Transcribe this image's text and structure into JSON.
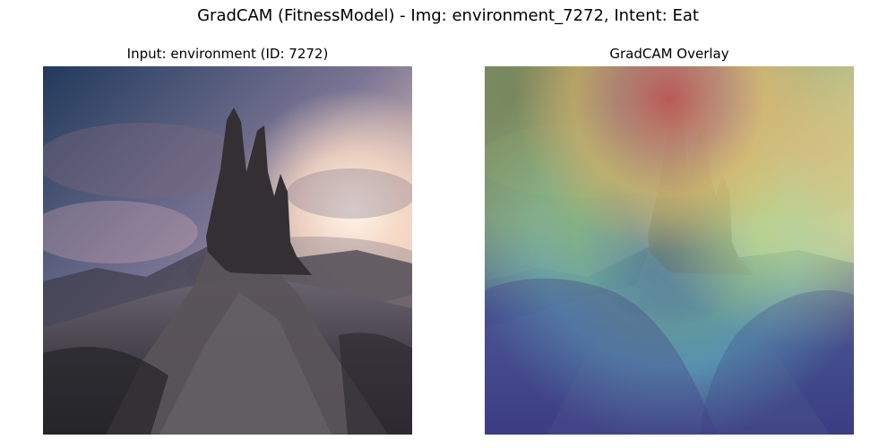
{
  "figure": {
    "suptitle": "GradCAM (FitnessModel) - Img: environment_7272, Intent: Eat"
  },
  "panels": {
    "input": {
      "title": "Input: environment (ID: 7272)"
    },
    "overlay": {
      "title": "GradCAM Overlay"
    }
  },
  "colors": {
    "sky_top": "#1f3454",
    "sky_glow": "#f6dcc5",
    "rock": "#3d3637",
    "ground": "#4b454b",
    "heat_hot": "#c63a3e",
    "heat_warm": "#f0c35a",
    "heat_mid": "#7dd6a0",
    "heat_cool": "#3e4fa6"
  }
}
